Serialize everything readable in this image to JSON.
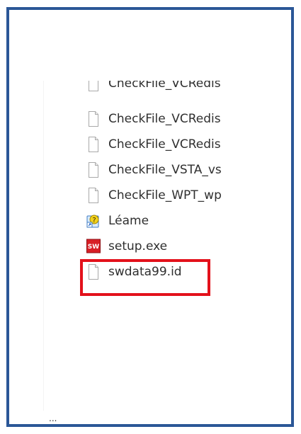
{
  "files": [
    {
      "name": "CheckFile_VCRedis",
      "icon": "blank-file-icon"
    },
    {
      "name": "CheckFile_VCRedis",
      "icon": "blank-file-icon"
    },
    {
      "name": "CheckFile_VCRedis",
      "icon": "blank-file-icon"
    },
    {
      "name": "CheckFile_VSTA_vs",
      "icon": "blank-file-icon"
    },
    {
      "name": "CheckFile_WPT_wp",
      "icon": "blank-file-icon"
    },
    {
      "name": "Léame",
      "icon": "help-shortcut-icon"
    },
    {
      "name": "setup.exe",
      "icon": "solidworks-icon"
    },
    {
      "name": "swdata99.id",
      "icon": "blank-file-icon"
    }
  ],
  "highlight": {
    "target": "setup.exe",
    "color": "#e3111b"
  },
  "frame": {
    "border_color": "#2b5797"
  },
  "solidworks_icon": {
    "text": "SW",
    "bg_color": "#d81f26"
  },
  "footer_fragment": "..."
}
